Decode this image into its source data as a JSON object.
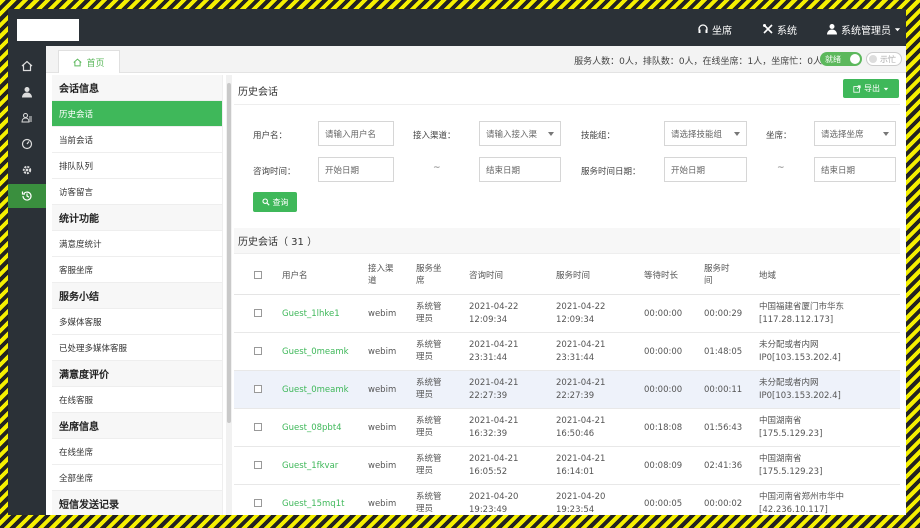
{
  "topbar": {
    "items": [
      {
        "label": "坐席",
        "icon": "headset-icon"
      },
      {
        "label": "系统",
        "icon": "tools-icon"
      },
      {
        "label": "系统管理员",
        "icon": "user-icon"
      }
    ]
  },
  "rail": {
    "icons": [
      "home-icon",
      "user-icon",
      "group-icon",
      "gauge-icon",
      "gear-icon",
      "history-icon"
    ],
    "active_index": 5
  },
  "tabstrip": {
    "home_label": "首页",
    "stats": "服务人数：0人，排队数：0人，在线坐席：1人，坐席忙：0人",
    "status_on": "就绪",
    "status_off": "示忙"
  },
  "menu": {
    "sections": [
      {
        "title": "会话信息",
        "items": [
          "历史会话",
          "当前会话",
          "排队队列",
          "访客留言"
        ]
      },
      {
        "title": "统计功能",
        "items": [
          "满意度统计",
          "客服坐席"
        ]
      },
      {
        "title": "服务小结",
        "items": [
          "多媒体客服",
          "已处理多媒体客服"
        ]
      },
      {
        "title": "满意度评价",
        "items": [
          "在线客服"
        ]
      },
      {
        "title": "坐席信息",
        "items": [
          "在线坐席",
          "全部坐席"
        ]
      },
      {
        "title": "短信发送记录",
        "items": []
      }
    ],
    "active": "历史会话"
  },
  "main": {
    "title": "历史会话",
    "export_label": "导出",
    "filters": {
      "username_label": "用户名：",
      "username_placeholder": "请输入用户名",
      "channel_label": "接入渠道：",
      "channel_placeholder": "请输入接入渠",
      "skill_label": "技能组：",
      "skill_placeholder": "请选择技能组",
      "agent_label": "坐席：",
      "agent_placeholder": "请选择坐席",
      "consult_time_label": "咨询时间：",
      "consult_start": "开始日期",
      "consult_end": "结束日期",
      "service_time_label": "服务时间日期：",
      "service_start": "开始日期",
      "service_end": "结束日期",
      "tilde": "~"
    },
    "query_label": "查询",
    "section_title": "历史会话（ 31 ）"
  },
  "table": {
    "headers": [
      "用户名",
      "接入渠道",
      "服务坐席",
      "咨询时间",
      "服务时间",
      "等待时长",
      "服务时间",
      "地域"
    ],
    "rows": [
      {
        "user": "Guest_1lhke1",
        "channel": "webim",
        "agent": "系统管理员",
        "consult_date": "2021-04-22",
        "consult_time": "12:09:34",
        "service_date": "2021-04-22",
        "service_time": "12:09:34",
        "wait": "00:00:00",
        "duration": "00:00:29",
        "region": "中国福建省厦门市华东",
        "ip": "[117.28.112.173]"
      },
      {
        "user": "Guest_0meamk",
        "channel": "webim",
        "agent": "系统管理员",
        "consult_date": "2021-04-21",
        "consult_time": "23:31:44",
        "service_date": "2021-04-21",
        "service_time": "23:31:44",
        "wait": "00:00:00",
        "duration": "01:48:05",
        "region": "未分配或者内网",
        "ip": "IP0[103.153.202.4]"
      },
      {
        "user": "Guest_0meamk",
        "channel": "webim",
        "agent": "系统管理员",
        "consult_date": "2021-04-21",
        "consult_time": "22:27:39",
        "service_date": "2021-04-21",
        "service_time": "22:27:39",
        "wait": "00:00:00",
        "duration": "00:00:11",
        "region": "未分配或者内网",
        "ip": "IP0[103.153.202.4]"
      },
      {
        "user": "Guest_08pbt4",
        "channel": "webim",
        "agent": "系统管理员",
        "consult_date": "2021-04-21",
        "consult_time": "16:32:39",
        "service_date": "2021-04-21",
        "service_time": "16:50:46",
        "wait": "00:18:08",
        "duration": "01:56:43",
        "region": "中国湖南省",
        "ip": "[175.5.129.23]"
      },
      {
        "user": "Guest_1fkvar",
        "channel": "webim",
        "agent": "系统管理员",
        "consult_date": "2021-04-21",
        "consult_time": "16:05:52",
        "service_date": "2021-04-21",
        "service_time": "16:14:01",
        "wait": "00:08:09",
        "duration": "02:41:36",
        "region": "中国湖南省",
        "ip": "[175.5.129.23]"
      },
      {
        "user": "Guest_15mq1t",
        "channel": "webim",
        "agent": "系统管理员",
        "consult_date": "2021-04-20",
        "consult_time": "19:23:49",
        "service_date": "2021-04-20",
        "service_time": "19:23:54",
        "wait": "00:00:05",
        "duration": "00:00:02",
        "region": "中国河南省郑州市华中",
        "ip": "[42.236.10.117]"
      }
    ]
  },
  "colors": {
    "accent": "#3fb85a",
    "topbar": "#2b3137",
    "highlight_row": "#eef2fa"
  }
}
